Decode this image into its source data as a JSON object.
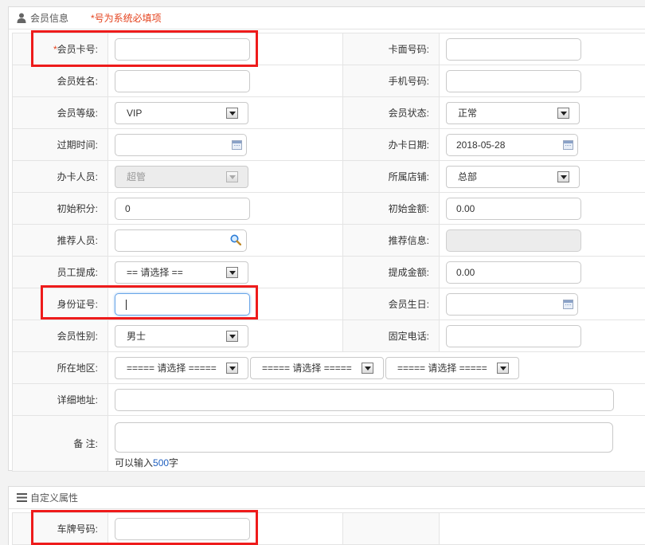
{
  "section1": {
    "title": "会员信息",
    "required_note": "*号为系统必填项"
  },
  "fields": {
    "card_no": {
      "required_mark": "*",
      "label": "会员卡号:",
      "value": ""
    },
    "face_no": {
      "label": "卡面号码:",
      "value": ""
    },
    "name": {
      "label": "会员姓名:",
      "value": ""
    },
    "phone": {
      "label": "手机号码:",
      "value": ""
    },
    "level": {
      "label": "会员等级:",
      "value": "VIP"
    },
    "status": {
      "label": "会员状态:",
      "value": "正常"
    },
    "expire": {
      "label": "过期时间:",
      "value": ""
    },
    "open_date": {
      "label": "办卡日期:",
      "value": "2018-05-28"
    },
    "operator": {
      "label": "办卡人员:",
      "value": "超管"
    },
    "store": {
      "label": "所属店铺:",
      "value": "总部"
    },
    "init_points": {
      "label": "初始积分:",
      "value": "0"
    },
    "init_amount": {
      "label": "初始金额:",
      "value": "0.00"
    },
    "referrer": {
      "label": "推荐人员:",
      "value": ""
    },
    "referrer_info": {
      "label": "推荐信息:",
      "value": ""
    },
    "commission_staff": {
      "label": "员工提成:",
      "value": "== 请选择 =="
    },
    "commission_amount": {
      "label": "提成金额:",
      "value": "0.00"
    },
    "id_card": {
      "label": "身份证号:",
      "value": ""
    },
    "birthday": {
      "label": "会员生日:",
      "value": ""
    },
    "gender": {
      "label": "会员性别:",
      "value": "男士"
    },
    "landline": {
      "label": "固定电话:",
      "value": ""
    },
    "region": {
      "label": "所在地区:",
      "province": "===== 请选择 =====",
      "city": "===== 请选择 =====",
      "district": "===== 请选择 ====="
    },
    "address": {
      "label": "详细地址:",
      "value": ""
    },
    "remark": {
      "label": "备 注:",
      "value": "",
      "hint_prefix": "可以输入",
      "hint_count": "500",
      "hint_suffix": "字"
    }
  },
  "section2": {
    "title": "自定义属性",
    "plate": {
      "label": "车牌号码:",
      "value": ""
    }
  },
  "colors": {
    "required": "#e4421d",
    "highlight_box": "#ee1b1b",
    "focus_border": "#6aa6e8"
  }
}
